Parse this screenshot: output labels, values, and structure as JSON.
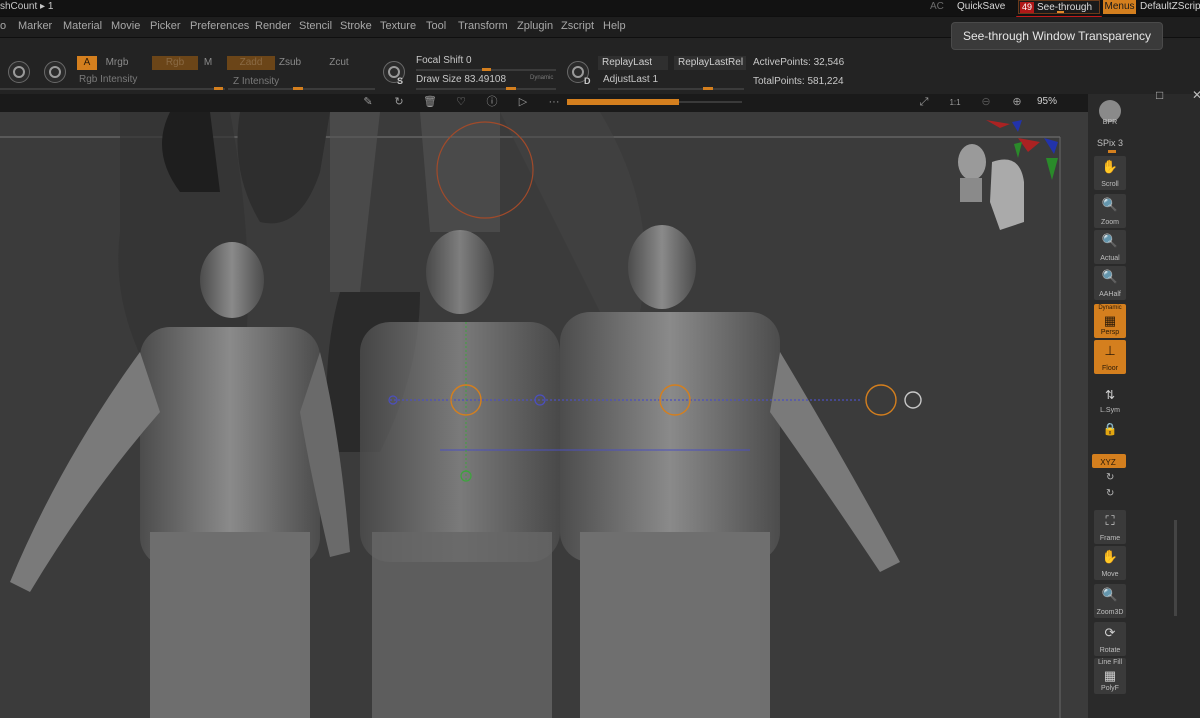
{
  "titlebar": {
    "mesh_count": "shCount ▸ 1",
    "ac": "AC",
    "quicksave": "QuickSave",
    "see_through_value": "49",
    "see_through_label": "See-through",
    "menus": "Menus",
    "default_zscript": "DefaultZScript"
  },
  "menubar": {
    "items": [
      "o",
      "Marker",
      "Material",
      "Movie",
      "Picker",
      "Preferences",
      "Render",
      "Stencil",
      "Stroke",
      "Texture",
      "Tool",
      "Transform",
      "Zplugin",
      "Zscript",
      "Help"
    ]
  },
  "tooltip": {
    "text": "See-through Window Transparency"
  },
  "shelf": {
    "a_btn": "A",
    "mrgb": "Mrgb",
    "rgb": "Rgb",
    "m": "M",
    "zadd": "Zadd",
    "zsub": "Zsub",
    "zcut": "Zcut",
    "rgb_intensity": "Rgb Intensity",
    "z_intensity": "Z Intensity",
    "focal_shift": "Focal Shift 0",
    "draw_size": "Draw Size 83.49108",
    "dynamic": "Dynamic",
    "replay_last": "ReplayLast",
    "replay_last_rel": "ReplayLastRel",
    "adjust_last": "AdjustLast 1",
    "active_points": "ActivePoints: 32,546",
    "total_points": "TotalPoints: 581,224",
    "s_label": "S",
    "d_label": "D"
  },
  "viewport_toolbar": {
    "zoom_pct": "95%"
  },
  "rail": {
    "buttons": [
      {
        "cap": "BPR"
      },
      {
        "cap": "SPix 3"
      },
      {
        "cap": "Scroll"
      },
      {
        "cap": "Zoom"
      },
      {
        "cap": "Actual"
      },
      {
        "cap": "AAHalf"
      },
      {
        "cap": "Dynamic"
      },
      {
        "cap": "Persp"
      },
      {
        "cap": "Floor"
      },
      {
        "cap": "L.Sym"
      },
      {
        "cap": "XYZ"
      },
      {
        "cap": "Frame"
      },
      {
        "cap": "Move"
      },
      {
        "cap": "Zoom3D"
      },
      {
        "cap": "Rotate"
      },
      {
        "cap": "Line Fill"
      },
      {
        "cap": "PolyF"
      }
    ]
  },
  "colors": {
    "accent_orange": "#d47f1e",
    "badge_red": "#b01818",
    "canvas_gray": "#3b3b3b"
  }
}
